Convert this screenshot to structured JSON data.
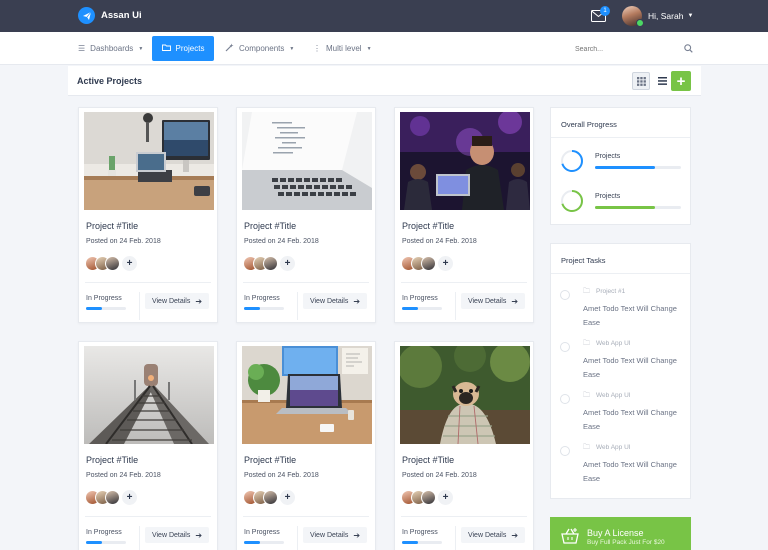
{
  "topbar": {
    "brand": "Assan Ui",
    "mail_badge": "1",
    "user_greeting": "Hi, Sarah"
  },
  "nav": {
    "items": [
      {
        "label": "Dashboards"
      },
      {
        "label": "Projects"
      },
      {
        "label": "Components"
      },
      {
        "label": "Multi level"
      }
    ],
    "active": "Projects",
    "search_placeholder": "Search..."
  },
  "content": {
    "title": "Active Projects"
  },
  "projects": [
    {
      "title": "Project #Title",
      "date": "Posted on 24 Feb. 2018",
      "status": "In Progress",
      "progress": 0.4,
      "button": "View Details",
      "image": "desk-imac"
    },
    {
      "title": "Project #Title",
      "date": "Posted on 24 Feb. 2018",
      "status": "In Progress",
      "progress": 0.4,
      "button": "View Details",
      "image": "laptop-code"
    },
    {
      "title": "Project #Title",
      "date": "Posted on 24 Feb. 2018",
      "status": "In Progress",
      "progress": 0.4,
      "button": "View Details",
      "image": "developer-hall"
    },
    {
      "title": "Project #Title",
      "date": "Posted on 24 Feb. 2018",
      "status": "In Progress",
      "progress": 0.4,
      "button": "View Details",
      "image": "railway-fog"
    },
    {
      "title": "Project #Title",
      "date": "Posted on 24 Feb. 2018",
      "status": "In Progress",
      "progress": 0.4,
      "button": "View Details",
      "image": "desk-macbook"
    },
    {
      "title": "Project #Title",
      "date": "Posted on 24 Feb. 2018",
      "status": "In Progress",
      "progress": 0.4,
      "button": "View Details",
      "image": "pug-blanket"
    }
  ],
  "overall_progress": {
    "title": "Overall Progress",
    "items": [
      {
        "name": "Projects",
        "value": 0.7,
        "color": "#1e90ff"
      },
      {
        "name": "Projects",
        "value": 0.7,
        "color": "#78c446"
      }
    ]
  },
  "project_tasks": {
    "title": "Project Tasks",
    "items": [
      {
        "category": "Project #1",
        "text": "Amet Todo Text Will Change Ease"
      },
      {
        "category": "Web App UI",
        "text": "Amet Todo Text Will Change Ease"
      },
      {
        "category": "Web App UI",
        "text": "Amet Todo Text Will Change Ease"
      },
      {
        "category": "Web App UI",
        "text": "Amet Todo Text Will Change Ease"
      }
    ]
  },
  "license": {
    "title": "Buy A License",
    "subtitle": "Buy Full Pack Just For $20"
  },
  "colors": {
    "topbar": "#3a3f51",
    "primary": "#1e90ff",
    "success": "#78c446"
  }
}
